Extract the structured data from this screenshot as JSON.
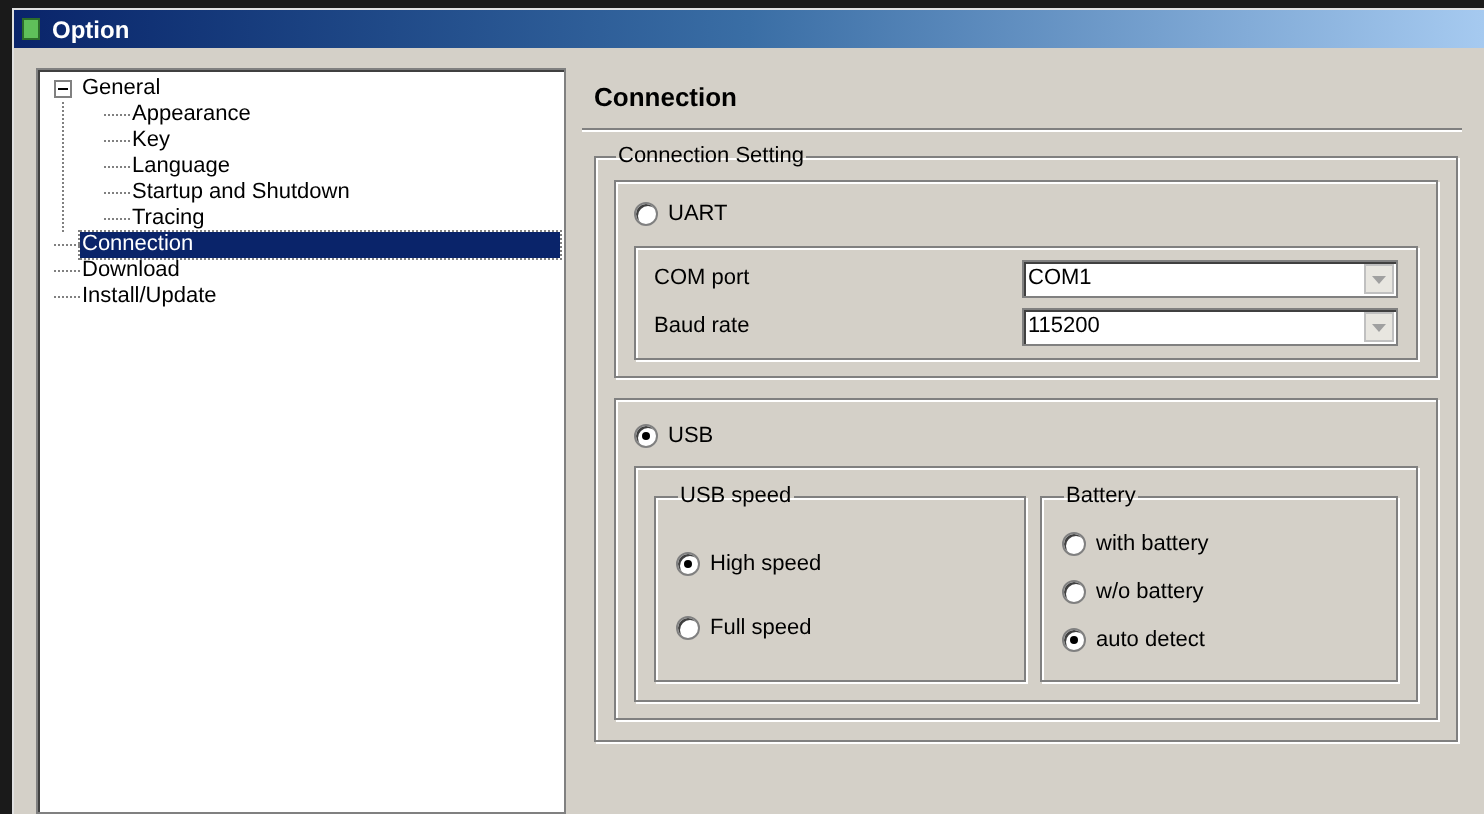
{
  "window": {
    "title": "Option"
  },
  "tree": [
    {
      "label": "General",
      "expanded": true,
      "selected": false,
      "children": [
        {
          "label": "Appearance",
          "selected": false
        },
        {
          "label": "Key",
          "selected": false
        },
        {
          "label": "Language",
          "selected": false
        },
        {
          "label": "Startup and Shutdown",
          "selected": false
        },
        {
          "label": "Tracing",
          "selected": false
        }
      ]
    },
    {
      "label": "Connection",
      "selected": true
    },
    {
      "label": "Download",
      "selected": false
    },
    {
      "label": "Install/Update",
      "selected": false
    }
  ],
  "page_title": "Connection",
  "connection_setting": {
    "title": "Connection Setting",
    "uart": {
      "label": "UART",
      "selected": false,
      "fields": [
        {
          "label": "COM port",
          "value": "COM1"
        },
        {
          "label": "Baud rate",
          "value": "115200"
        }
      ]
    },
    "usb": {
      "label": "USB",
      "selected": true,
      "usb_speed": {
        "title": "USB speed",
        "options": [
          {
            "label": "High speed",
            "selected": true
          },
          {
            "label": "Full speed",
            "selected": false
          }
        ]
      },
      "battery": {
        "title": "Battery",
        "options": [
          {
            "label": "with battery",
            "selected": false
          },
          {
            "label": "w/o battery",
            "selected": false
          },
          {
            "label": "auto detect",
            "selected": true
          }
        ]
      }
    }
  }
}
